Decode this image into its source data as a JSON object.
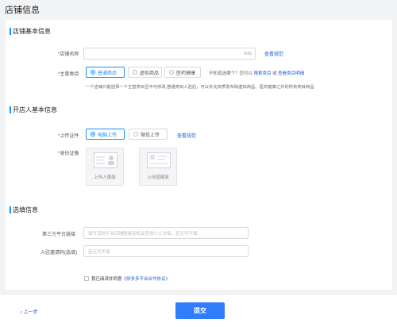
{
  "page_title": "店铺信息",
  "sections": {
    "basic": {
      "title": "店铺基本信息",
      "shop_name": {
        "label": "店铺名称",
        "value": "",
        "placeholder": "",
        "counter": "0/30",
        "link": "查看规范"
      },
      "category": {
        "label": "主营类目",
        "options": [
          "普通商品",
          "虚拟商品",
          "医药健康"
        ],
        "selected": "普通商品",
        "tip_prefix": "不知道选哪个？您可以",
        "tip_link1": "搜索类目",
        "tip_or": "或",
        "tip_link2": "查看类目明细",
        "hint": "一个店铺只能选择一个主营类目且不可修改,普通类目入驻后，可以补充资质发布除虚拟商品、医药健康之外的所有类目商品"
      }
    },
    "owner": {
      "title": "开店人基本信息",
      "upload_method": {
        "label": "上传证件",
        "options": [
          "电脑上传",
          "微信上传"
        ],
        "selected": "电脑上传",
        "link": "查看规范"
      },
      "id_card": {
        "label": "身份证像",
        "front_caption": "上传人像面",
        "back_caption": "上传国徽面"
      }
    },
    "optional": {
      "title": "选填信息",
      "third_party": {
        "label": "第三方平台链接",
        "placeholder": "填写其他平台店铺链接有机会获得小二对接，若无可不填"
      },
      "invite_code": {
        "label": "入驻邀请码(选填)",
        "placeholder": "若无可不填"
      }
    }
  },
  "agreement": {
    "text": "我已阅读并同意",
    "link": "《拼多多平台合作协议》"
  },
  "footer": {
    "back_label": "上一步",
    "submit_label": "提交"
  },
  "colors": {
    "accent": "#2f7dfb",
    "link": "#1e5bd6",
    "required": "#f5222d"
  }
}
